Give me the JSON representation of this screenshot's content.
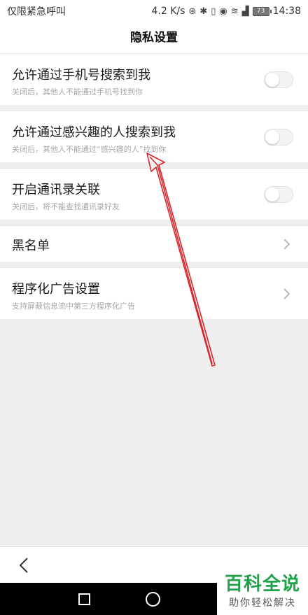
{
  "status_bar": {
    "carrier": "仅限紧急呼叫",
    "speed": "4.2 K/s",
    "battery": "73",
    "time": "14:38"
  },
  "title": "隐私设置",
  "items": [
    {
      "title": "允许通过手机号搜索到我",
      "subtitle": "关闭后，其他人不能通过手机号找到你",
      "control": "toggle",
      "on": false
    },
    {
      "title": "允许通过感兴趣的人搜索到我",
      "subtitle": "关闭后，其他人不能通过“感兴趣的人”找到你",
      "control": "toggle",
      "on": false
    },
    {
      "title": "开启通讯录关联",
      "subtitle": "关闭后，将不能查找通讯录好友",
      "control": "toggle",
      "on": false
    },
    {
      "title": "黑名单",
      "subtitle": "",
      "control": "chevron"
    },
    {
      "title": "程序化广告设置",
      "subtitle": "支持屏蔽信息流中第三方程序化广告",
      "control": "chevron"
    }
  ],
  "watermark": {
    "main": "百科全说",
    "sub": "助你轻松解决"
  },
  "colors": {
    "annotation_arrow": "#d9262c",
    "watermark_green": "#1fa24a"
  }
}
